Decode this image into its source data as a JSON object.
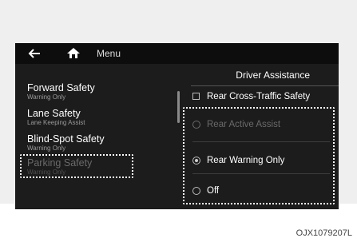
{
  "topbar": {
    "menu_label": "Menu"
  },
  "left_list": [
    {
      "title": "Forward Safety",
      "subtitle": "Warning Only"
    },
    {
      "title": "Lane Safety",
      "subtitle": "Lane Keeping Assist"
    },
    {
      "title": "Blind-Spot Safety",
      "subtitle": "Warning Only"
    },
    {
      "title": "Parking Safety",
      "subtitle": "Warning Only",
      "highlighted": true
    }
  ],
  "right_panel": {
    "title": "Driver Assistance",
    "checkbox": {
      "label": "Rear Cross-Traffic Safety",
      "checked": false
    },
    "options": [
      {
        "label": "Rear Active Assist",
        "selected": false,
        "enabled": false
      },
      {
        "label": "Rear Warning Only",
        "selected": true,
        "enabled": true
      },
      {
        "label": "Off",
        "selected": false,
        "enabled": true
      }
    ]
  },
  "caption": "OJX1079207L",
  "colors": {
    "screen_bg": "#1c1c1c",
    "topbar_bg": "#0d0d0d",
    "panel_bg": "#efefef"
  },
  "icons": {
    "back": "back-arrow-icon",
    "home": "home-icon"
  }
}
